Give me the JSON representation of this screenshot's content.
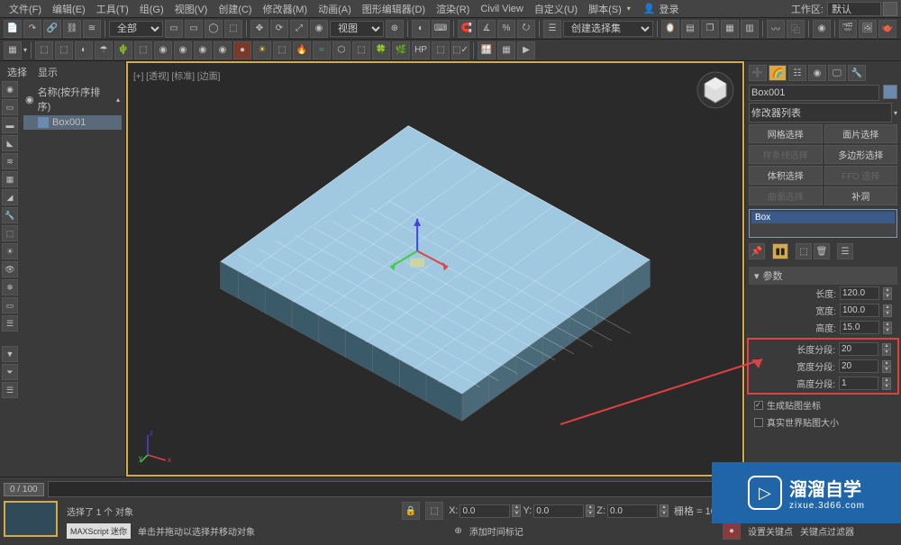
{
  "menu": {
    "items": [
      "文件(F)",
      "编辑(E)",
      "工具(T)",
      "组(G)",
      "视图(V)",
      "创建(C)",
      "修改器(M)",
      "动画(A)",
      "图形编辑器(D)",
      "渲染(R)",
      "Civil View",
      "自定义(U)",
      "脚本(S)"
    ],
    "login": "登录",
    "workspace_label": "工作区:",
    "workspace_value": "默认"
  },
  "toolbar1": {
    "combo1": "全部",
    "combo2": "创建选择集"
  },
  "left": {
    "tab_select": "选择",
    "tab_display": "显示",
    "tree_header": "名称(按升序排序)",
    "tree_item": "Box001"
  },
  "viewport": {
    "label": "[+]  [透视]  [标准]  [边面]"
  },
  "right": {
    "object_name": "Box001",
    "modifier_list": "修改器列表",
    "btns": {
      "mesh_sel": "网格选择",
      "face_sel": "面片选择",
      "spline_sel": "样条线选择",
      "poly_sel": "多边形选择",
      "vol_sel": "体积选择",
      "ffd_sel": "FFD 选择",
      "surf_sel": "曲面选择",
      "fill": "补洞"
    },
    "stack_item": "Box",
    "rollout_params": "参数",
    "params": {
      "length_label": "长度:",
      "length_value": "120.0",
      "width_label": "宽度:",
      "width_value": "100.0",
      "height_label": "高度:",
      "height_value": "15.0",
      "lsegs_label": "长度分段:",
      "lsegs_value": "20",
      "wsegs_label": "宽度分段:",
      "wsegs_value": "20",
      "hsegs_label": "高度分段:",
      "hsegs_value": "1"
    },
    "cb_genmap": "生成贴图坐标",
    "cb_realworld": "真实世界贴图大小"
  },
  "timeline": {
    "range": "0  /  100"
  },
  "status": {
    "sel_text": "选择了 1 个 对象",
    "hint": "单击并拖动以选择并移动对象",
    "x_label": "X:",
    "x_value": "0.0",
    "y_label": "Y:",
    "y_value": "0.0",
    "z_label": "Z:",
    "z_value": "0.0",
    "grid_label": "栅格 = 10.0",
    "script_label": "MAXScript 迷你",
    "addtime": "添加时间标记",
    "key_set": "设置关键点",
    "key_filter": "关键点过滤器"
  },
  "watermark": {
    "big": "溜溜自学",
    "small": "zixue.3d66.com"
  }
}
